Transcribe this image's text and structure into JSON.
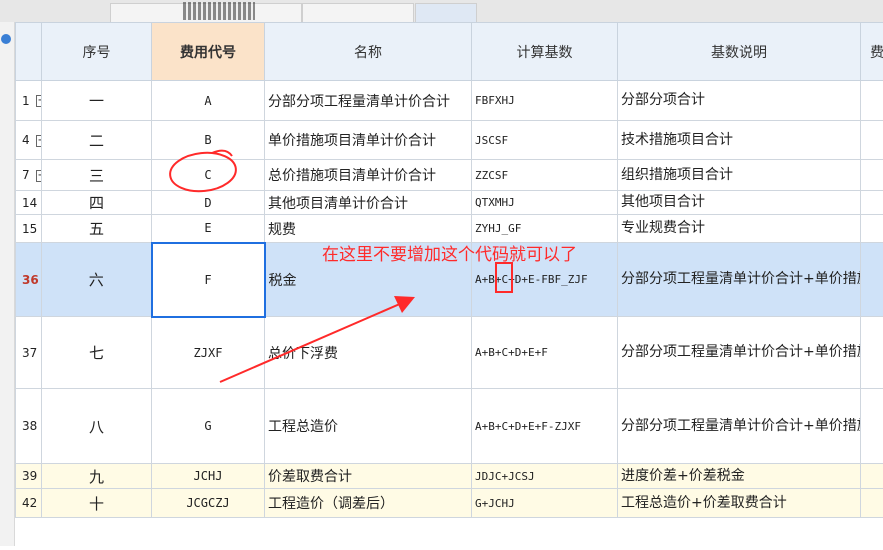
{
  "header": {
    "seq": "序号",
    "code": "费用代号",
    "name": "名称",
    "base": "计算基数",
    "base_desc": "基数说明",
    "rate": "费"
  },
  "rows": [
    {
      "rn": "1",
      "expand": true,
      "seq": "一",
      "code": "A",
      "name": "分部分项工程量清单计价合计",
      "base": "FBFXHJ",
      "desc": "分部分项合计"
    },
    {
      "rn": "4",
      "expand": true,
      "seq": "二",
      "code": "B",
      "name": "单价措施项目清单计价合计",
      "base": "JSCSF",
      "desc": "技术措施项目合计"
    },
    {
      "rn": "7",
      "expand": true,
      "seq": "三",
      "code": "C",
      "name": "总价措施项目清单计价合计",
      "base": "ZZCSF",
      "desc": "组织措施项目合计"
    },
    {
      "rn": "14",
      "expand": false,
      "seq": "四",
      "code": "D",
      "name": "其他项目清单计价合计",
      "base": "QTXMHJ",
      "desc": "其他项目合计"
    },
    {
      "rn": "15",
      "expand": true,
      "seq": "五",
      "code": "E",
      "name": "规费",
      "base": "ZYHJ_GF",
      "desc": "专业规费合计"
    },
    {
      "rn": "36",
      "expand": false,
      "seq": "六",
      "code": "F",
      "name": "税金",
      "base": "A+B+C+D+E-FBF_ZJF",
      "desc": "分部分项工程量清单计价合计+单价措施项目清单计价合计+总价措施项目清单计价合计+其他项目清单计价合计+规费-分包费_直接费"
    },
    {
      "rn": "37",
      "expand": false,
      "seq": "七",
      "code": "ZJXF",
      "name": "总价下浮费",
      "base": "A+B+C+D+E+F",
      "desc": "分部分项工程量清单计价合计+单价措施项目清单计价合计+总价措施项目清单计价合计+其他项目清单计价合计+规费+税金"
    },
    {
      "rn": "38",
      "expand": false,
      "seq": "八",
      "code": "G",
      "name": "工程总造价",
      "base": "A+B+C+D+E+F-ZJXF",
      "desc": "分部分项工程量清单计价合计+单价措施项目清单计价合计+总价措施项目清单计价合计+其他项目清单计价合计+规费+税金-总价下浮费"
    },
    {
      "rn": "39",
      "expand": true,
      "seq": "九",
      "code": "JCHJ",
      "name": "价差取费合计",
      "base": "JDJC+JCSJ",
      "desc": "进度价差+价差税金"
    },
    {
      "rn": "42",
      "expand": false,
      "seq": "十",
      "code": "JCGCZJ",
      "name": "工程造价（调差后）",
      "base": "G+JCHJ",
      "desc": "工程总造价+价差取费合计"
    }
  ],
  "annotation": {
    "text": "在这里不要增加这个代码就可以了",
    "color": "#ff2a2a"
  },
  "colors": {
    "header_bg": "#eaf1f9",
    "active_header_bg": "#fbe3c9",
    "selected_row_bg": "#cfe2f8",
    "selection_border": "#1f6fe0",
    "highlight_rows_bg": "#fffbe5"
  }
}
